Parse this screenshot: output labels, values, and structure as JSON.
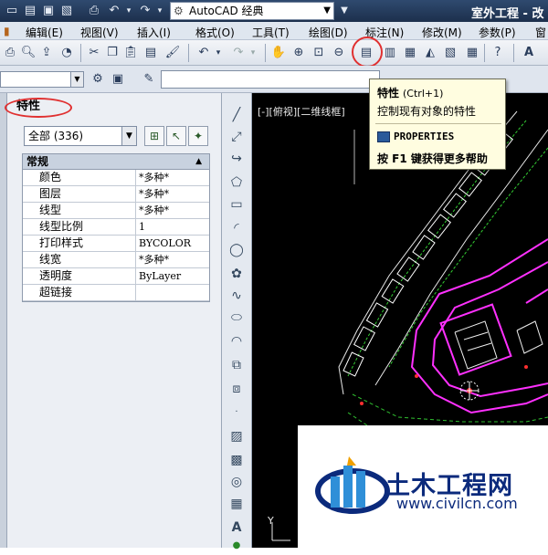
{
  "window": {
    "workspace": "AutoCAD 经典",
    "app_title": "室外工程 - 改"
  },
  "menu": [
    "编辑(E)",
    "视图(V)",
    "插入(I)",
    "格式(O)",
    "工具(T)",
    "绘图(D)",
    "标注(N)",
    "修改(M)",
    "参数(P)",
    "窗"
  ],
  "properties": {
    "title": "特性",
    "selection": "全部 (336)",
    "section": "常规",
    "rows": [
      {
        "key": "颜色",
        "value": "*多种*"
      },
      {
        "key": "图层",
        "value": "*多种*"
      },
      {
        "key": "线型",
        "value": "*多种*"
      },
      {
        "key": "线型比例",
        "value": "1"
      },
      {
        "key": "打印样式",
        "value": "BYCOLOR"
      },
      {
        "key": "线宽",
        "value": "*多种*"
      },
      {
        "key": "透明度",
        "value": "ByLayer"
      },
      {
        "key": "超链接",
        "value": ""
      }
    ]
  },
  "viewport": {
    "label": "[-][俯视][二维线框]"
  },
  "tooltip": {
    "title": "特性",
    "shortcut": "(Ctrl+1)",
    "description": "控制现有对象的特性",
    "command": "PROPERTIES",
    "help": "按 F1 键获得更多帮助"
  },
  "watermark": {
    "name": "土木工程网",
    "url": "www.civilcn.com"
  },
  "colors": {
    "title_bar": "#1c2f4c",
    "drawing_bg": "#000000",
    "annotation_red": "#e03030",
    "magenta_lines": "#ff30ff",
    "tooltip_bg": "#fffde0"
  }
}
